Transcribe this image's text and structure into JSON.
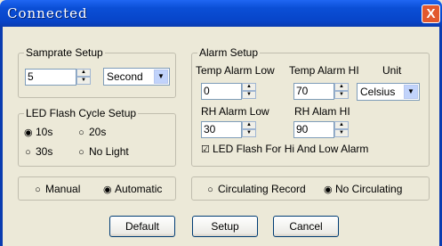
{
  "window": {
    "title": "Connected",
    "close_glyph": "X"
  },
  "samprate": {
    "legend": "Samprate Setup",
    "value": "5",
    "unit_selected": "Second"
  },
  "led_cycle": {
    "legend": "LED Flash Cycle Setup",
    "options": [
      {
        "label": "10s",
        "checked": true
      },
      {
        "label": "20s",
        "checked": false
      },
      {
        "label": "30s",
        "checked": false
      },
      {
        "label": "No Light",
        "checked": false
      }
    ]
  },
  "alarm": {
    "legend": "Alarm Setup",
    "temp_low_label": "Temp Alarm Low",
    "temp_low_value": "0",
    "temp_hi_label": "Temp Alarm HI",
    "temp_hi_value": "70",
    "unit_label": "Unit",
    "unit_selected": "Celsius",
    "rh_low_label": "RH Alarm Low",
    "rh_low_value": "30",
    "rh_hi_label": "RH Alam HI",
    "rh_hi_value": "90",
    "led_flash_label": "LED Flash For Hi And Low  Alarm",
    "led_flash_checked": true
  },
  "mode": {
    "manual": "Manual",
    "automatic": "Automatic",
    "selected": "automatic"
  },
  "record": {
    "circulating": "Circulating Record",
    "no_circulating": "No Circulating",
    "selected": "no_circulating"
  },
  "buttons": {
    "default": "Default",
    "setup": "Setup",
    "cancel": "Cancel"
  }
}
